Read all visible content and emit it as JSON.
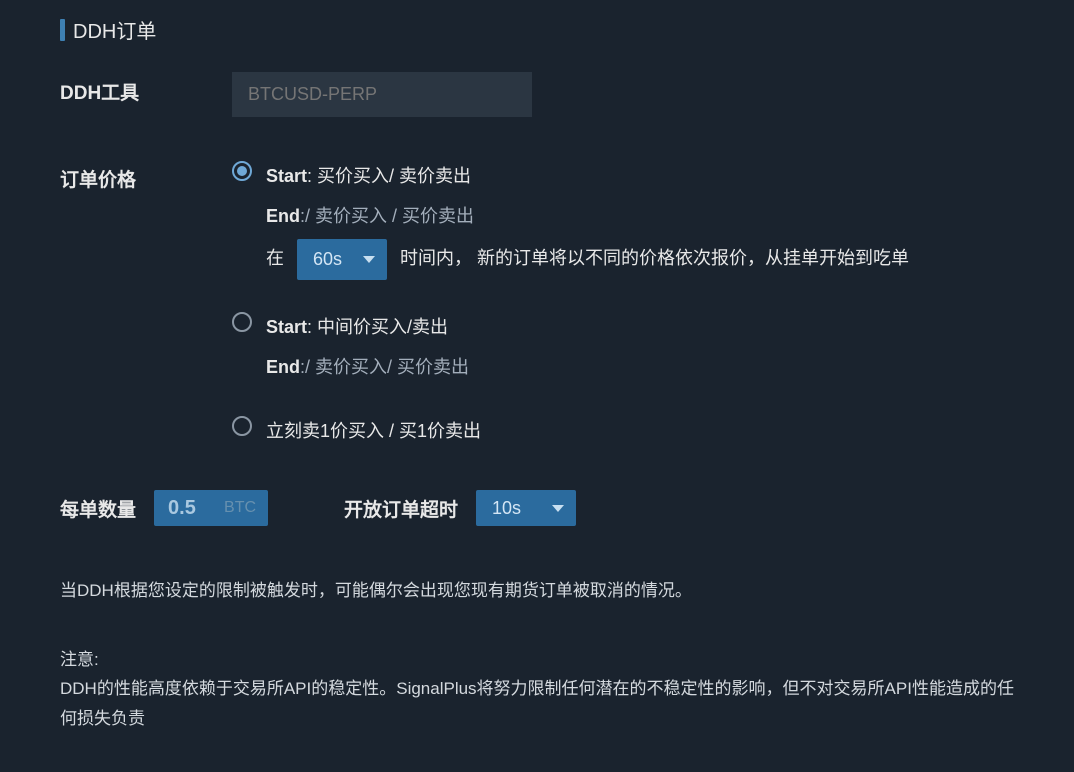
{
  "section": {
    "title": "DDH订单"
  },
  "tool": {
    "label": "DDH工具",
    "placeholder": "BTCUSD-PERP"
  },
  "price": {
    "label": "订单价格",
    "options": [
      {
        "selected": true,
        "start_label": "Start",
        "start_text": ": 买价买入/ 卖价卖出",
        "end_label": "End",
        "end_text": ":/ 卖价买入  / 买价卖出",
        "timing_prefix": "在",
        "timing_value": "60s",
        "timing_suffix": " 时间内， 新的订单将以不同的价格依次报价，从挂单开始到吃单"
      },
      {
        "selected": false,
        "start_label": "Start",
        "start_text": ": 中间价买入/卖出",
        "end_label": "End",
        "end_text": ":/ 卖价买入/ 买价卖出"
      },
      {
        "selected": false,
        "text": "立刻卖1价买入 / 买1价卖出"
      }
    ]
  },
  "qty": {
    "label": "每单数量",
    "value": "0.5",
    "unit": "BTC"
  },
  "timeout": {
    "label": "开放订单超时",
    "value": "10s"
  },
  "info": "当DDH根据您设定的限制被触发时，可能偶尔会出现您现有期货订单被取消的情况。",
  "note": {
    "label": "注意:",
    "text": "DDH的性能高度依赖于交易所API的稳定性。SignalPlus将努力限制任何潜在的不稳定性的影响，但不对交易所API性能造成的任何损失负责"
  }
}
